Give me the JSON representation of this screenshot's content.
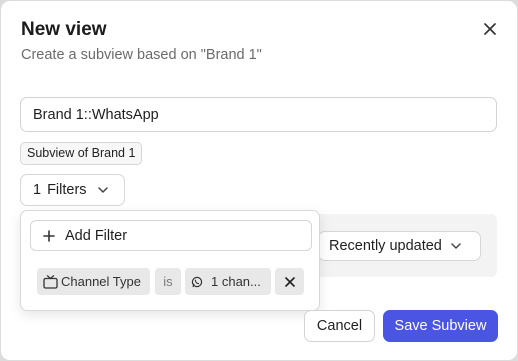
{
  "dialog": {
    "title": "New view",
    "subtitle": "Create a subview based on \"Brand 1\"",
    "close_icon": "close-icon"
  },
  "form": {
    "name_value": "Brand 1::WhatsApp",
    "subview_badge": "Subview of Brand 1",
    "filters_button": {
      "count": "1",
      "label": "Filters",
      "icon": "chevron-down-icon"
    },
    "sort_button": {
      "label": "Recently updated",
      "icon": "chevron-down-icon"
    }
  },
  "filter_dropdown": {
    "add_filter_label": "Add Filter",
    "add_icon": "plus-icon",
    "filters": [
      {
        "field": "Channel Type",
        "field_icon": "tv-icon",
        "operator": "is",
        "value": "1 chan...",
        "value_icon": "whatsapp-icon",
        "remove_icon": "close-icon"
      }
    ]
  },
  "footer": {
    "cancel_label": "Cancel",
    "save_label": "Save Subview"
  },
  "colors": {
    "primary": "#4a55e3",
    "muted_text": "#6b6b6b",
    "chip_bg": "#e8e8e8"
  }
}
